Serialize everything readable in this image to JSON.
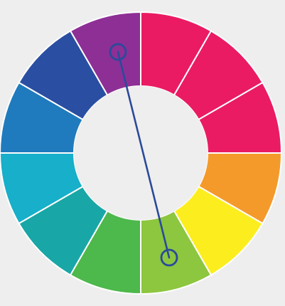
{
  "wheel": {
    "segments": [
      {
        "name": "purple",
        "color": "#8e2f96"
      },
      {
        "name": "magenta-1",
        "color": "#ea1b63"
      },
      {
        "name": "magenta-2",
        "color": "#ea1b63"
      },
      {
        "name": "magenta-3",
        "color": "#ea1b63"
      },
      {
        "name": "orange",
        "color": "#f49a2b"
      },
      {
        "name": "yellow",
        "color": "#fced1f"
      },
      {
        "name": "yellow-green",
        "color": "#8dc63f"
      },
      {
        "name": "green",
        "color": "#4db84b"
      },
      {
        "name": "teal",
        "color": "#18a7a6"
      },
      {
        "name": "cyan",
        "color": "#17afc9"
      },
      {
        "name": "blue",
        "color": "#1f7bbd"
      },
      {
        "name": "indigo",
        "color": "#2a4ea2"
      }
    ],
    "connector": {
      "color": "#2a4a9a",
      "from_segment": "purple",
      "to_segment": "yellow-green"
    }
  }
}
